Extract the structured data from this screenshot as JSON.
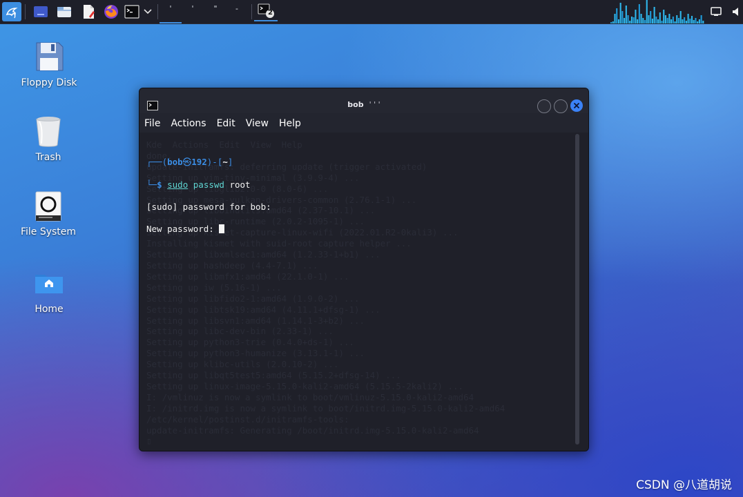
{
  "panel": {
    "launchers": [
      {
        "icon": "kali-dragon-icon"
      },
      {
        "icon": "show-desktop-icon"
      },
      {
        "icon": "file-manager-icon"
      },
      {
        "icon": "text-editor-icon"
      },
      {
        "icon": "firefox-icon"
      },
      {
        "icon": "terminal-icon"
      },
      {
        "icon": "chevron-down-icon"
      }
    ],
    "workspaces": [
      "'",
      "'",
      "\"",
      "-"
    ],
    "task": {
      "icon": "terminal-task-icon",
      "badge": "2"
    },
    "tray": [
      "display-icon",
      "volume-icon"
    ],
    "accent": "#3e8fe0"
  },
  "desktop": {
    "icons": [
      {
        "label": "Floppy Disk",
        "icon": "floppy-disk-icon"
      },
      {
        "label": "Trash",
        "icon": "trash-icon"
      },
      {
        "label": "File System",
        "icon": "file-system-icon"
      },
      {
        "label": "Home",
        "icon": "home-folder-icon"
      }
    ]
  },
  "terminal": {
    "title": "bob",
    "title_suffix": "' ' '",
    "menu": [
      "File",
      "Actions",
      "Edit",
      "View",
      "Help"
    ],
    "prompt": {
      "open": "┌──(",
      "user": "bob",
      "at": "㉿",
      "host": "192",
      "mid": ")-[",
      "dir": "~",
      "close": "]",
      "lead": "└─",
      "dollar": "$"
    },
    "command": {
      "cmd": "sudo",
      "args": "passwd",
      "rest": "root"
    },
    "output": [
      "[sudo] password for bob:",
      "New password: "
    ],
    "background_log": [
      "Kde  Actions  Edit  View  Help",
      "done.",
      "update-initramfs: deferring update (trigger activated)",
      "Setting up vim-tiny-minimal (3.9.9-4) ...",
      "Setting up libglib2.0-0 (8.0-6) ...",
      "Setting up mesa-vulkan-drivers-common (2.76.1-1) ...",
      "Setting up libbinutils:amd64 (2.37-10.1) ...",
      "Setting up libc-runtime (2.0.2-1095-1) ...",
      "Setting up kismet-capture-linux-wifi (2022.01.R2-0kali3) ...",
      "Installing kismet with suid-root capture helper ...",
      "Setting up libxmlsec1:amd64 (1.2.33-1+b1) ...",
      "Setting up hashdeep (4.4-7.1) ...",
      "Setting up libmfx1:amd64 (22.1.0-1) ...",
      "Setting up iw (5.16-1) ...",
      "Setting up libfido2-1:amd64 (1.9.0-2) ...",
      "Setting up libtsk19:amd64 (4.11.1+dfsg-1) ...",
      "Setting up libsvn1:amd64 (1.14.1-3+b2) ...",
      "Setting up libc-dev-bin (2.33-1) ...",
      "Setting up python3-trie (0.4.0+ds-1) ...",
      "Setting up python3-humanize (3.13.1-1) ...",
      "Setting up klibc-utils (2.0.10-2) ...",
      "Setting up libqt5test5:amd64 (5.15.2+dfsg-14) ...",
      "Setting up linux-image-5.15.0-kali2-amd64 (5.15.5-2kali2) ...",
      "I: /vmlinuz is now a symlink to boot/vmlinuz-5.15.0-kali2-amd64",
      "I: /initrd.img is now a symlink to boot/initrd.img-5.15.0-kali2-amd64",
      "/etc/kernel/postinst.d/initramfs-tools:",
      "update-initramfs: Generating /boot/initrd.img-5.15.0-kali2-amd64",
      "▯"
    ],
    "colors": {
      "prompt": "#3b8ee6",
      "command": "#5fd5d2",
      "close_button": "#3b82f6"
    }
  },
  "watermark": "CSDN @八道胡说"
}
